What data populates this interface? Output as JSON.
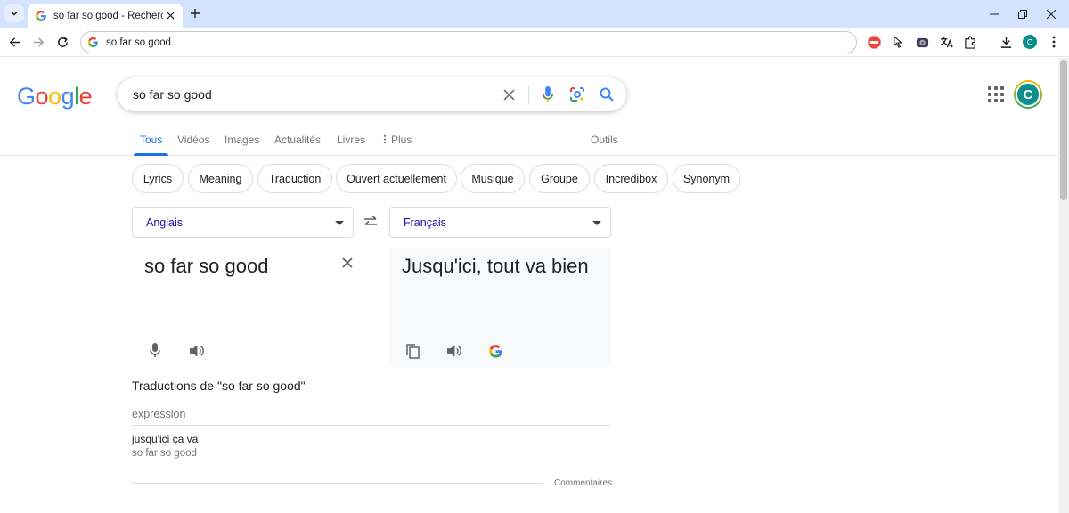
{
  "browser": {
    "tab_title": "so far so good - Recherche Goo",
    "url": "so far so good"
  },
  "google": {
    "logo_letters": [
      "G",
      "o",
      "o",
      "g",
      "l",
      "e"
    ],
    "query": "so far so good",
    "avatar_letter": "C",
    "tabs": [
      {
        "label": "Tous",
        "active": true
      },
      {
        "label": "Vidéos"
      },
      {
        "label": "Images"
      },
      {
        "label": "Actualités"
      },
      {
        "label": "Livres"
      },
      {
        "label": "Plus"
      },
      {
        "label": "Outils"
      }
    ],
    "chips": [
      "Lyrics",
      "Meaning",
      "Traduction",
      "Ouvert actuellement",
      "Musique",
      "Groupe",
      "Incredibox",
      "Synonym"
    ]
  },
  "translate": {
    "source_lang": "Anglais",
    "target_lang": "Français",
    "source_text": "so far so good",
    "target_text": "Jusqu'ici, tout va bien",
    "translations_heading": "Traductions de \"so far so good\"",
    "category": "expression",
    "translation_word": "jusqu'ici ça va",
    "back_translation": "so far so good",
    "feedback": "Commentaires"
  },
  "colors": {
    "accent": "#1a73e8",
    "tab_strip": "#d3e3fd",
    "avatar": "#0a8f8b"
  }
}
